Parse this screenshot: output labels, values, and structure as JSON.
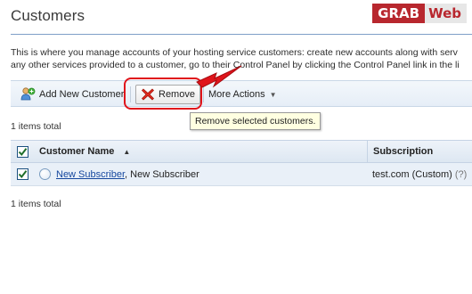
{
  "page": {
    "title": "Customers"
  },
  "watermark": {
    "part1": "GRAB",
    "part2": "Web"
  },
  "intro": {
    "line1": "This is where you manage accounts of your hosting service customers: create new accounts along with serv",
    "line2": "any other services provided to a customer, go to their Control Panel by clicking the Control Panel link in the li"
  },
  "toolbar": {
    "add_label": "Add New Customer",
    "remove_label": "Remove",
    "more_label": "More Actions"
  },
  "tooltip": {
    "text": "Remove selected customers."
  },
  "summary": {
    "top": "1 items total",
    "bottom": "1 items total"
  },
  "table": {
    "columns": {
      "name": "Customer Name",
      "subscription": "Subscription"
    },
    "rows": [
      {
        "name_link": "New Subscriber",
        "name_rest": ", New Subscriber",
        "subscription": "test.com (Custom)",
        "help": "(?)",
        "checked": true
      }
    ]
  },
  "colors": {
    "annotation_red": "#e0141b",
    "link_blue": "#15479e",
    "toolbar_bg": "#e6eef7"
  },
  "icons": {
    "add": "add-user-icon",
    "remove": "red-x-icon",
    "caret": "chevron-down-icon",
    "sort": "sort-ascending-icon",
    "status": "status-circle-icon",
    "checkbox": "checkmark-icon",
    "annotation": "red-arrow-icon"
  }
}
